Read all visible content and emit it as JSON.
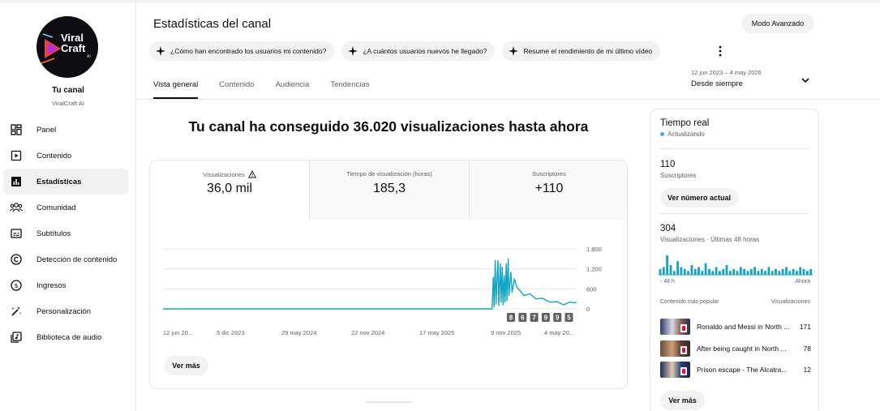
{
  "channel": {
    "logo_line1": "Viral",
    "logo_line2": "Craft",
    "logo_sub": "AI",
    "title": "Tu canal",
    "name": "ViralCraft AI"
  },
  "sidebar": {
    "items": [
      {
        "label": "Panel",
        "icon": "dashboard-icon"
      },
      {
        "label": "Contenido",
        "icon": "content-icon"
      },
      {
        "label": "Estadísticas",
        "icon": "analytics-icon",
        "active": true
      },
      {
        "label": "Comunidad",
        "icon": "community-icon"
      },
      {
        "label": "Subtítulos",
        "icon": "subtitles-icon"
      },
      {
        "label": "Detección de contenido",
        "icon": "copyright-icon"
      },
      {
        "label": "Ingresos",
        "icon": "earn-icon"
      },
      {
        "label": "Personalización",
        "icon": "customization-icon"
      },
      {
        "label": "Biblioteca de audio",
        "icon": "audio-library-icon"
      }
    ]
  },
  "header": {
    "title": "Estadísticas del canal",
    "advanced_mode": "Modo Avanzado",
    "chips": [
      "¿Cómo han encontrado los usuarios mi contenido?",
      "¿A cuántos usuarios nuevos he llegado?",
      "Resume el rendimiento de mi último vídeo"
    ],
    "tabs": [
      "Vista general",
      "Contenido",
      "Audiencia",
      "Tendencias"
    ],
    "active_tab": 0,
    "date_range": "12 jun 2023 – 4 may 2026",
    "date_label": "Desde siempre"
  },
  "main": {
    "headline": "Tu canal ha conseguido 36.020 visualizaciones hasta ahora",
    "metrics": [
      {
        "label": "Visualizaciones",
        "value": "36,0 mil",
        "warning": true
      },
      {
        "label": "Tiempo de visualización (horas)",
        "value": "185,3"
      },
      {
        "label": "Suscriptores",
        "value": "+110"
      }
    ],
    "see_more": "Ver más"
  },
  "chart_data": {
    "type": "line",
    "title": "",
    "xlabel": "",
    "ylabel": "",
    "ylim": [
      0,
      1800
    ],
    "yticks": [
      "1.800",
      "1.200",
      "600",
      "0"
    ],
    "yticks_values": [
      1800,
      1200,
      600,
      0
    ],
    "xticks": [
      "12 jun 20...",
      "5 dic 2023",
      "29 may 2024",
      "22 nov 2024",
      "17 may 2025",
      "9 nov 2025",
      "4 may 20..."
    ],
    "x_range": [
      "2023-06-12",
      "2026-05-04"
    ],
    "series": [
      {
        "color": "#12a4c4",
        "values": [
          {
            "x": "2023-06-12",
            "y": 0
          },
          {
            "x": "2025-09-30",
            "y": 0
          },
          {
            "x": "2025-10-03",
            "y": 950
          },
          {
            "x": "2025-10-05",
            "y": 60
          },
          {
            "x": "2025-10-08",
            "y": 1450
          },
          {
            "x": "2025-10-10",
            "y": 150
          },
          {
            "x": "2025-10-13",
            "y": 1050
          },
          {
            "x": "2025-10-15",
            "y": 1450
          },
          {
            "x": "2025-10-17",
            "y": 100
          },
          {
            "x": "2025-10-21",
            "y": 1350
          },
          {
            "x": "2025-10-23",
            "y": 200
          },
          {
            "x": "2025-10-26",
            "y": 1250
          },
          {
            "x": "2025-10-28",
            "y": 120
          },
          {
            "x": "2025-10-31",
            "y": 1000
          },
          {
            "x": "2025-11-02",
            "y": 200
          },
          {
            "x": "2025-11-05",
            "y": 1350
          },
          {
            "x": "2025-11-07",
            "y": 250
          },
          {
            "x": "2025-11-10",
            "y": 1500
          },
          {
            "x": "2025-11-12",
            "y": 400
          },
          {
            "x": "2025-11-17",
            "y": 1100
          },
          {
            "x": "2025-11-20",
            "y": 500
          },
          {
            "x": "2025-11-26",
            "y": 900
          },
          {
            "x": "2025-12-02",
            "y": 650
          },
          {
            "x": "2025-12-10",
            "y": 550
          },
          {
            "x": "2025-12-20",
            "y": 400
          },
          {
            "x": "2026-01-05",
            "y": 450
          },
          {
            "x": "2026-01-20",
            "y": 300
          },
          {
            "x": "2026-02-05",
            "y": 320
          },
          {
            "x": "2026-02-25",
            "y": 200
          },
          {
            "x": "2026-03-15",
            "y": 220
          },
          {
            "x": "2026-04-01",
            "y": 120
          },
          {
            "x": "2026-04-15",
            "y": 200
          },
          {
            "x": "2026-05-04",
            "y": 180
          }
        ]
      }
    ],
    "video_markers": [
      "8",
      "6",
      "7",
      "9",
      "9",
      "5"
    ],
    "grid": true
  },
  "realtime": {
    "title": "Tiempo real",
    "status": "Actualizando",
    "subs_value": "110",
    "subs_label": "Suscriptores",
    "subs_button": "Ver número actual",
    "views_value": "304",
    "views_label": "Visualizaciones · Últimas 48 horas",
    "axis_start": "- 48 h",
    "axis_end": "Ahora",
    "spark_values": [
      3,
      4,
      10,
      5,
      2,
      7,
      4,
      3,
      2,
      5,
      3,
      4,
      2,
      6,
      3,
      2,
      4,
      2,
      3,
      5,
      2,
      3,
      2,
      4,
      3,
      2,
      3,
      4,
      2,
      3,
      2,
      4,
      2,
      3,
      2,
      3,
      4,
      2,
      3,
      2,
      4,
      3,
      2,
      3
    ],
    "top_content_label": "Contenido más popular",
    "views_col_label": "Visualizaciones",
    "videos": [
      {
        "title": "Ronaldo and Messi in North ...",
        "views": "171"
      },
      {
        "title": "After being caught in North ...",
        "views": "78"
      },
      {
        "title": "Prison escape - The Alcatra...",
        "views": "12"
      }
    ],
    "see_more": "Ver más"
  }
}
